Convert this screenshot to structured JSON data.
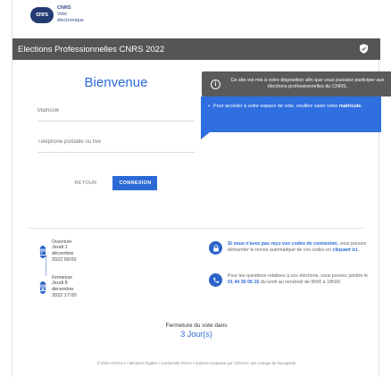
{
  "header": {
    "logo_badge": "cnrs",
    "logo_brand": "CNRS",
    "logo_line2": "Vote",
    "logo_line3": "électronique"
  },
  "titlebar": {
    "title": "Elections Professionnelles CNRS 2022"
  },
  "login": {
    "heading": "Bienvenue",
    "matricule_placeholder": "Matricule",
    "phone_placeholder": "Téléphone portable ou fixe",
    "back_label": "RETOUR",
    "login_label": "CONNEXION"
  },
  "tooltip": {
    "text": "Ce site est mis à votre disposition afin que vous puissiez participer aux élections professionnelles du CNRS."
  },
  "blue_card": {
    "text_before": "Pour accéder à votre espace de vote, veuillez saisir votre",
    "text_bold": "matricule."
  },
  "timeline": {
    "opening_label": "Ouverture",
    "opening_date": "Jeudi 1 décembre 2022 09:00",
    "closing_label": "Fermeture",
    "closing_date": "Jeudi 8 décembre 2022 17:00"
  },
  "help": {
    "codes_link": "Si vous n'avez pas reçu vos codes de connexion,",
    "codes_text": "vous pouvez demander le renvoi automatique de vos codes en",
    "codes_click": "cliquant ici.",
    "phone_text_1": "Pour les questions relatives à ces élections, vous pouvez joindre le",
    "phone_number": "01 44 30 05 15",
    "phone_text_2": "du lundi au vendredi de 9h00 à 18h00."
  },
  "countdown": {
    "label": "Fermeture du vote dans",
    "value": "3 Jour(s)"
  },
  "footer": {
    "text": "© 2022 VOXALY • Mentions légales • Conformité RGAA • Solution proposée par VOXALY, une marque de Docaposte"
  },
  "colors": {
    "accent": "#2b6ad6",
    "titlebar": "#555555",
    "card": "#2f6fe0"
  }
}
